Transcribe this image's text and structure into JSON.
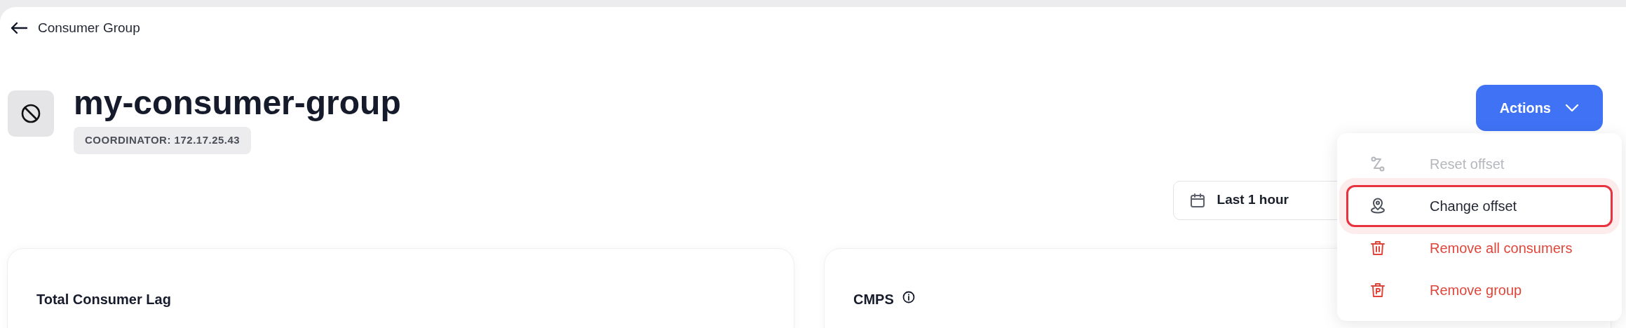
{
  "breadcrumb": {
    "label": "Consumer Group"
  },
  "header": {
    "title": "my-consumer-group",
    "badge": "COORDINATOR: 172.17.25.43"
  },
  "actions_button": {
    "label": "Actions",
    "expanded": true
  },
  "actions_menu": [
    {
      "label": "Reset offset",
      "kind": "route",
      "disabled": true,
      "danger": false,
      "selected": false
    },
    {
      "label": "Change offset",
      "kind": "pin",
      "disabled": false,
      "danger": false,
      "selected": true
    },
    {
      "label": "Remove all consumers",
      "kind": "trash",
      "disabled": false,
      "danger": true,
      "selected": false
    },
    {
      "label": "Remove group",
      "kind": "bin",
      "disabled": false,
      "danger": true,
      "selected": false
    }
  ],
  "time_range": {
    "label": "Last 1 hour"
  },
  "cards": [
    {
      "title": "Total Consumer Lag",
      "info": false
    },
    {
      "title": "CMPS",
      "info": true
    }
  ]
}
